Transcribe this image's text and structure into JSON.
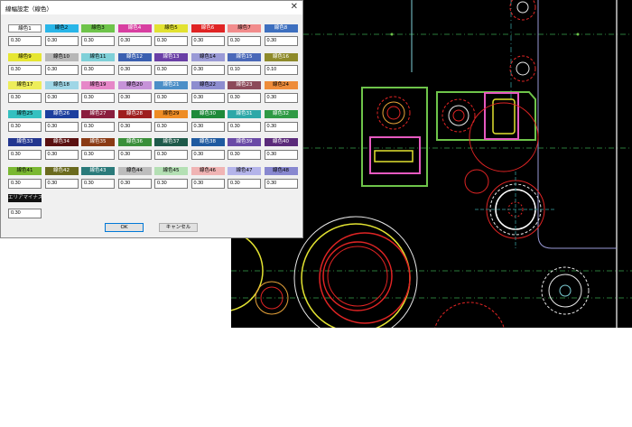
{
  "dialog": {
    "title": "線幅設定（線色）",
    "close_label": "✕",
    "ok_label": "OK",
    "cancel_label": "キャンセル"
  },
  "colors": [
    {
      "label": "線色1",
      "bg": "#ffffff",
      "fg": "#000000",
      "value": "0.30"
    },
    {
      "label": "線色2",
      "bg": "#29b6e8",
      "fg": "#000000",
      "value": "0.30"
    },
    {
      "label": "線色3",
      "bg": "#6ec44a",
      "fg": "#000000",
      "value": "0.30"
    },
    {
      "label": "線色4",
      "bg": "#d83fa1",
      "fg": "#ffffff",
      "value": "0.30"
    },
    {
      "label": "線色5",
      "bg": "#e2e231",
      "fg": "#000000",
      "value": "0.30"
    },
    {
      "label": "線色6",
      "bg": "#e02424",
      "fg": "#ffffff",
      "value": "0.30"
    },
    {
      "label": "線色7",
      "bg": "#f28c8c",
      "fg": "#000000",
      "value": "0.30"
    },
    {
      "label": "線色8",
      "bg": "#3d6fbf",
      "fg": "#ffffff",
      "value": "0.30"
    },
    {
      "label": "線色9",
      "bg": "#e6e632",
      "fg": "#000000",
      "value": "0.30"
    },
    {
      "label": "線色10",
      "bg": "#b7b7b7",
      "fg": "#000000",
      "value": "0.30"
    },
    {
      "label": "線色11",
      "bg": "#7fd0d8",
      "fg": "#000000",
      "value": "0.30"
    },
    {
      "label": "線色12",
      "bg": "#3a5fb0",
      "fg": "#ffffff",
      "value": "0.30"
    },
    {
      "label": "線色13",
      "bg": "#6a3fa6",
      "fg": "#ffffff",
      "value": "0.30"
    },
    {
      "label": "線色14",
      "bg": "#9a9ad6",
      "fg": "#000000",
      "value": "0.30"
    },
    {
      "label": "線色15",
      "bg": "#4a68b8",
      "fg": "#ffffff",
      "value": "0.10"
    },
    {
      "label": "線色16",
      "bg": "#8e8a2a",
      "fg": "#ffffff",
      "value": "0.10"
    },
    {
      "label": "線色17",
      "bg": "#eded5a",
      "fg": "#000000",
      "value": "0.30"
    },
    {
      "label": "線色18",
      "bg": "#9fd6e6",
      "fg": "#000000",
      "value": "0.30"
    },
    {
      "label": "線色19",
      "bg": "#e687c8",
      "fg": "#000000",
      "value": "0.30"
    },
    {
      "label": "線色20",
      "bg": "#c693d8",
      "fg": "#000000",
      "value": "0.30"
    },
    {
      "label": "線色21",
      "bg": "#4c8fc7",
      "fg": "#ffffff",
      "value": "0.30"
    },
    {
      "label": "線色22",
      "bg": "#8d8dcf",
      "fg": "#000000",
      "value": "0.30"
    },
    {
      "label": "線色23",
      "bg": "#8c4a5a",
      "fg": "#ffffff",
      "value": "0.30"
    },
    {
      "label": "線色24",
      "bg": "#ee8c3a",
      "fg": "#000000",
      "value": "0.30"
    },
    {
      "label": "線色25",
      "bg": "#34c0c0",
      "fg": "#000000",
      "value": "0.30"
    },
    {
      "label": "線色26",
      "bg": "#1c3f9e",
      "fg": "#ffffff",
      "value": "0.30"
    },
    {
      "label": "線色27",
      "bg": "#8a1e3e",
      "fg": "#ffffff",
      "value": "0.30"
    },
    {
      "label": "線色28",
      "bg": "#9e1e1e",
      "fg": "#ffffff",
      "value": "0.30"
    },
    {
      "label": "線色29",
      "bg": "#ee8c24",
      "fg": "#000000",
      "value": "0.30"
    },
    {
      "label": "線色30",
      "bg": "#1f8a3a",
      "fg": "#ffffff",
      "value": "0.30"
    },
    {
      "label": "線色31",
      "bg": "#2da8a8",
      "fg": "#ffffff",
      "value": "0.30"
    },
    {
      "label": "線色32",
      "bg": "#2f9a44",
      "fg": "#ffffff",
      "value": "0.30"
    },
    {
      "label": "線色33",
      "bg": "#23368f",
      "fg": "#ffffff",
      "value": "0.30"
    },
    {
      "label": "線色34",
      "bg": "#5a1010",
      "fg": "#ffffff",
      "value": "0.30"
    },
    {
      "label": "線色35",
      "bg": "#8a3a14",
      "fg": "#ffffff",
      "value": "0.30"
    },
    {
      "label": "線色36",
      "bg": "#3a8f3a",
      "fg": "#ffffff",
      "value": "0.30"
    },
    {
      "label": "線色37",
      "bg": "#1e5a4a",
      "fg": "#ffffff",
      "value": "0.30"
    },
    {
      "label": "線色38",
      "bg": "#1f5aa0",
      "fg": "#ffffff",
      "value": "0.30"
    },
    {
      "label": "線色39",
      "bg": "#6a4aa6",
      "fg": "#ffffff",
      "value": "0.30"
    },
    {
      "label": "線色40",
      "bg": "#5a2a7a",
      "fg": "#ffffff",
      "value": "0.30"
    },
    {
      "label": "線色41",
      "bg": "#7ab832",
      "fg": "#000000",
      "value": "0.30"
    },
    {
      "label": "線色42",
      "bg": "#6a6a1e",
      "fg": "#ffffff",
      "value": "0.30"
    },
    {
      "label": "線色43",
      "bg": "#2a7a7a",
      "fg": "#ffffff",
      "value": "0.30"
    },
    {
      "label": "線色44",
      "bg": "#bdbdbd",
      "fg": "#000000",
      "value": "0.30"
    },
    {
      "label": "線色45",
      "bg": "#b4e0b4",
      "fg": "#000000",
      "value": "0.30"
    },
    {
      "label": "線色46",
      "bg": "#f0b4b4",
      "fg": "#000000",
      "value": "0.30"
    },
    {
      "label": "線色47",
      "bg": "#b4b4ea",
      "fg": "#000000",
      "value": "0.30"
    },
    {
      "label": "線色48",
      "bg": "#8888d0",
      "fg": "#000000",
      "value": "0.30"
    }
  ],
  "aux": {
    "label": "エリアマイナス色",
    "bg": "#111111",
    "fg": "#e0e0e0",
    "value": "0.30"
  }
}
